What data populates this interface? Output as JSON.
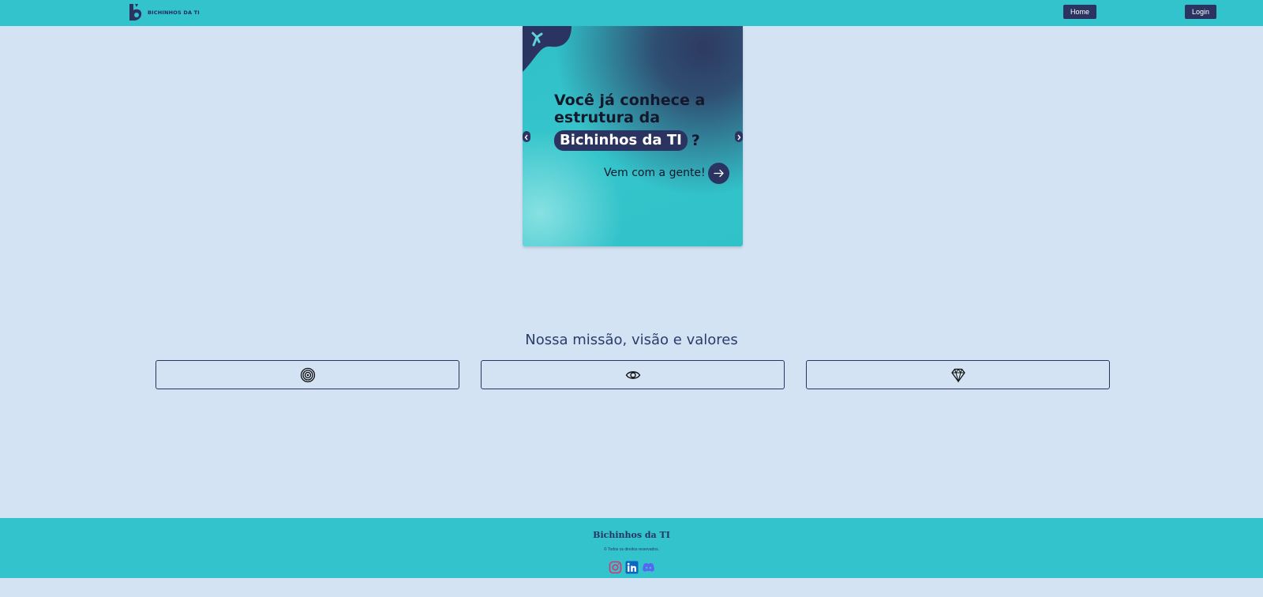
{
  "header": {
    "logo_text": "BICHINHOS DA TI",
    "nav": {
      "home_label": "Home",
      "login_label": "Login"
    },
    "colors": {
      "bar": "#33c3cc",
      "button": "#2b3461"
    }
  },
  "carousel": {
    "headline": "Você já conhece a estrutura da",
    "highlight": "Bichinhos da TI",
    "question_mark": "?",
    "cta_text": "Vem com a gente!",
    "prev_icon": "chevron-left-icon",
    "next_icon": "chevron-right-icon"
  },
  "mission": {
    "title": "Nossa missão, visão e valores",
    "cards": [
      {
        "icon": "target-icon"
      },
      {
        "icon": "eye-icon"
      },
      {
        "icon": "diamond-icon"
      }
    ]
  },
  "footer": {
    "title": "Bichinhos da TI",
    "copyright": "© Todos os direitos reservados.",
    "social": [
      {
        "icon": "instagram-icon",
        "color": "#e1306c"
      },
      {
        "icon": "linkedin-icon",
        "color": "#0a66c2"
      },
      {
        "icon": "discord-icon",
        "color": "#5865f2"
      }
    ]
  }
}
